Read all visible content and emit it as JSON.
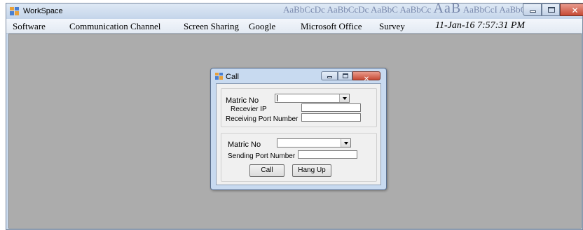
{
  "window": {
    "title": "WorkSpace",
    "background_text_1": "AaBbCcDc AaBbCcDc",
    "background_text_2": "AaBbC AaBbCc",
    "background_text_3": "AaB",
    "background_text_4": "AaBbCcI AaBbCcDd",
    "close_glyph": "✕"
  },
  "menu": {
    "items": [
      "Software",
      "Communication Channel",
      "Screen Sharing",
      "Google",
      "Microsoft Office",
      "Survey"
    ],
    "datetime": "11-Jan-16 7:57:31 PM"
  },
  "dialog": {
    "title": "Call",
    "close_glyph": "✕",
    "receive_group": {
      "matric_label": "Matric No",
      "matric_value": "",
      "receiver_ip_label": "Recevier IP",
      "receiver_ip_value": "",
      "receiving_port_label": "Receiving Port Number",
      "receiving_port_value": ""
    },
    "send_group": {
      "matric_label": "Matric No",
      "matric_value": "",
      "sending_port_label": "Sending Port Number",
      "sending_port_value": ""
    },
    "call_button": "Call",
    "hangup_button": "Hang Up"
  },
  "colors": {
    "window_frame": "#c9d9ec",
    "client_area": "#acacac",
    "close_button": "#c64a35"
  },
  "icons": {
    "app": "workspace-app-icon",
    "dialog": "call-form-icon",
    "dropdown": "chevron-down-icon"
  }
}
